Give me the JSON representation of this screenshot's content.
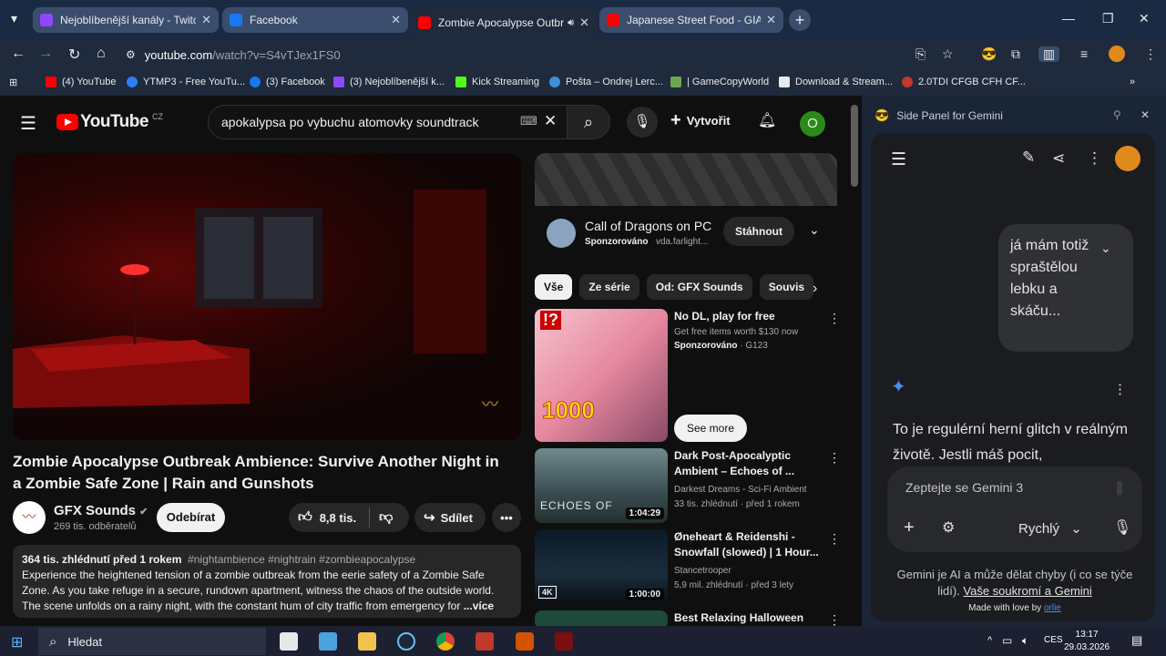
{
  "browser": {
    "tabs": [
      {
        "title": "Nejoblíbenější kanály - Twitch",
        "color": "#9146ff",
        "active": false
      },
      {
        "title": "Facebook",
        "color": "#1877f2",
        "active": false
      },
      {
        "title": "Zombie Apocalypse Outbre",
        "color": "#ff0000",
        "active": true
      },
      {
        "title": "Japanese Street Food - GIANT",
        "color": "#ff0000",
        "active": false
      }
    ],
    "url_host": "youtube.com",
    "url_path": "/watch?v=S4vTJex1FS0",
    "bookmarks": [
      "(4) YouTube",
      "YTMP3 - Free YouTu...",
      "(3) Facebook",
      "(3) Nejoblíbenější k...",
      "Kick Streaming",
      "Pošta – Ondrej Lerc...",
      "| GameCopyWorld",
      "Download & Stream...",
      "2.0TDI CFGB CFH CF..."
    ]
  },
  "youtube": {
    "logo_text": "YouTube",
    "country": "CZ",
    "search_query": "apokalypsa po vybuchu atomovky soundtrack",
    "create_label": "Vytvořit",
    "avatar_letter": "O",
    "video": {
      "title": "Zombie Apocalypse Outbreak Ambience: Survive Another Night in a Zombie Safe Zone | Rain and Gunshots",
      "channel": "GFX Sounds",
      "subscribers": "269 tis. odběratelů",
      "subscribe_label": "Odebírat",
      "likes": "8,8 tis.",
      "share_label": "Sdílet",
      "views_date": "364 tis. zhlédnutí  před 1 rokem",
      "tags": "#nightambience #nightrain #zombieapocalypse",
      "description": "Experience the heightened tension of a zombie outbreak from the eerie safety of a Zombie Safe Zone. As you take refuge in a secure, rundown apartment, witness the chaos of the outside world. The scene unfolds on a rainy night, with the constant hum of city traffic from emergency for",
      "more_label": "...více"
    },
    "ad": {
      "title": "Call of Dragons on PC",
      "sponsored": "Sponzorováno",
      "domain": "vda.farlight...",
      "cta": "Stáhnout"
    },
    "chips": [
      "Vše",
      "Ze série",
      "Od: GFX Sounds",
      "Souvis"
    ],
    "recommendations": [
      {
        "title": "No DL, play for free",
        "line1": "Get free items worth $130 now",
        "line2": "Sponzorováno",
        "line2b": "G123",
        "cta": "See more",
        "duration": ""
      },
      {
        "title": "Dark Post-Apocalyptic Ambient – Echoes of ...",
        "line1": "Darkest Dreams - Sci-Fi Ambient",
        "line2": "33 tis. zhlédnutí · před 1 rokem",
        "duration": "1:04:29",
        "thumb_text": "ECHOES OF"
      },
      {
        "title": "Øneheart & Reidenshi - Snowfall (slowed) | 1 Hour...",
        "line1": "Stancetrooper",
        "line2": "5,9 mil. zhlédnutí · před 3 lety",
        "duration": "1:00:00",
        "badge": "4K"
      },
      {
        "title": "Best Relaxing Halloween",
        "line1": "",
        "line2": "",
        "duration": ""
      }
    ]
  },
  "gemini": {
    "panel_title": "Side Panel for Gemini",
    "user_message": "já mám totiž spraštělou lebku a skáču...",
    "reply": "To je regulérní herní glitch v reálným životě. Jestli máš pocit,",
    "input_placeholder": "Zeptejte se Gemini 3",
    "mode_label": "Rychlý",
    "disclaimer": "Gemini je AI a může dělat chyby (i co se týče lidí).",
    "privacy_link": "Vaše soukromí a Gemini",
    "made_with": "Made with love by",
    "made_with_author": "orlie"
  },
  "taskbar": {
    "search_label": "Hledat",
    "language": "CES",
    "time": "13:17",
    "date": "29.03.2026"
  }
}
